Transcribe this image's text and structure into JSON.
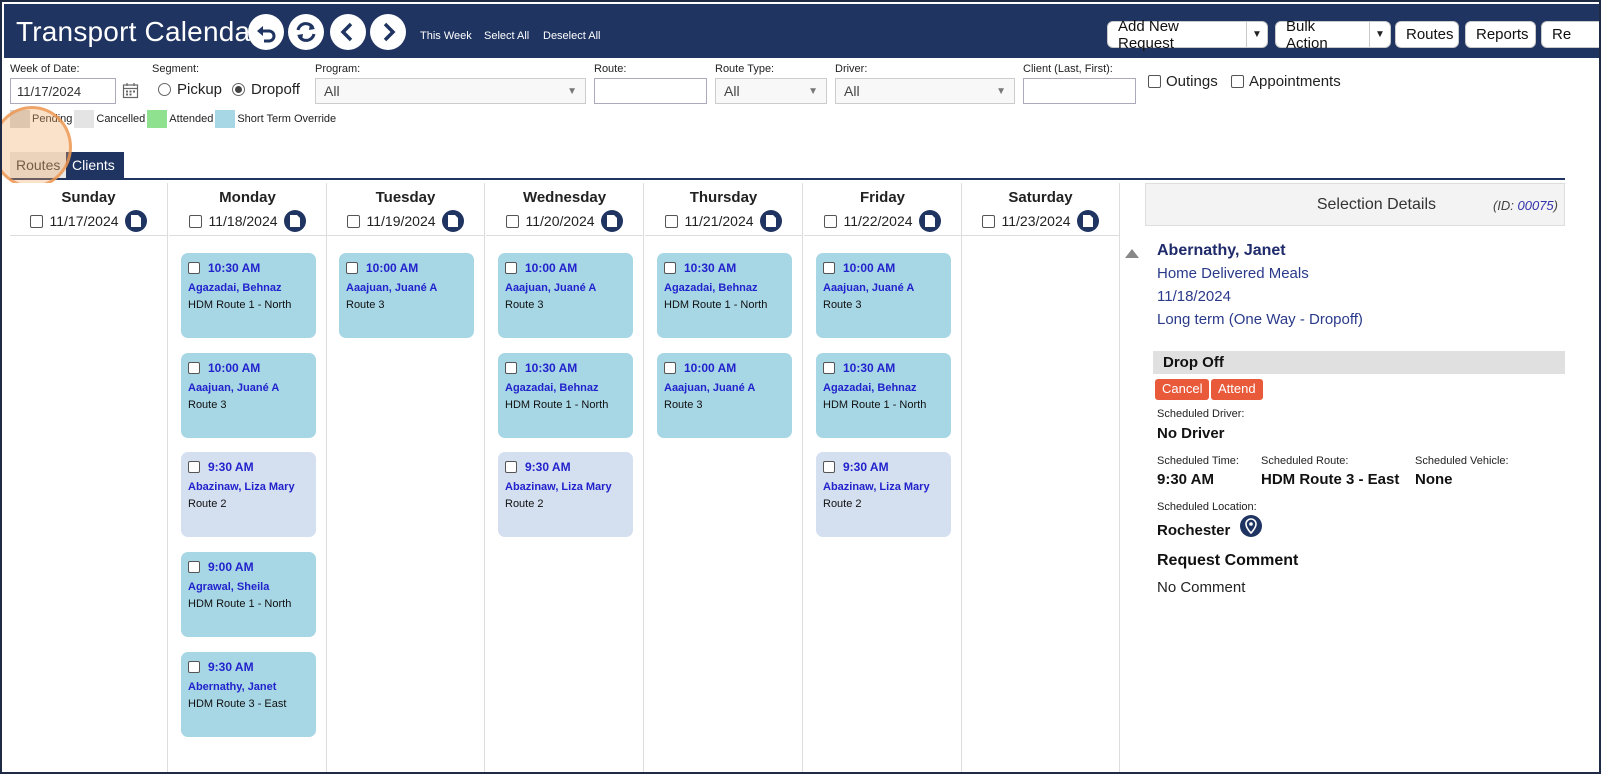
{
  "header": {
    "title": "Transport Calendar",
    "links": {
      "this_week": "This Week",
      "select_all": "Select All",
      "deselect_all": "Deselect All"
    },
    "buttons": {
      "add_new_request": "Add New Request",
      "bulk_action": "Bulk Action",
      "routes": "Routes",
      "reports": "Reports",
      "re": "Re"
    }
  },
  "filters": {
    "week_of_date_label": "Week of Date:",
    "week_of_date_value": "11/17/2024",
    "segment_label": "Segment:",
    "segment_pickup": "Pickup",
    "segment_dropoff": "Dropoff",
    "program_label": "Program:",
    "program_value": "All",
    "route_label": "Route:",
    "route_value": "",
    "route_type_label": "Route Type:",
    "route_type_value": "All",
    "driver_label": "Driver:",
    "driver_value": "All",
    "client_label": "Client (Last, First):",
    "client_value": "",
    "outings": "Outings",
    "appointments": "Appointments"
  },
  "legend": [
    {
      "label": "Pending",
      "color": "#d4d4d4"
    },
    {
      "label": "Cancelled",
      "color": "#e4e4e4"
    },
    {
      "label": "Attended",
      "color": "#8fe08f"
    },
    {
      "label": "Short Term Override",
      "color": "#a7d6e5"
    }
  ],
  "tabs": {
    "routes": "Routes",
    "clients": "Clients"
  },
  "days": [
    {
      "name": "Sunday",
      "date": "11/17/2024",
      "cards": []
    },
    {
      "name": "Monday",
      "date": "11/18/2024",
      "cards": [
        {
          "time": "10:30 AM",
          "client": "Agazadai, Behnaz",
          "route": "HDM Route 1 - North",
          "status": "short"
        },
        {
          "time": "10:00 AM",
          "client": "Aaajuan, Juané A",
          "route": "Route 3",
          "status": "short"
        },
        {
          "time": "9:30 AM",
          "client": "Abazinaw, Liza Mary",
          "route": "Route 2",
          "status": "pending"
        },
        {
          "time": "9:00 AM",
          "client": "Agrawal, Sheila",
          "route": "HDM Route 1 - North",
          "status": "short"
        },
        {
          "time": "9:30 AM",
          "client": "Abernathy, Janet",
          "route": "HDM Route 3 - East",
          "status": "short"
        }
      ]
    },
    {
      "name": "Tuesday",
      "date": "11/19/2024",
      "cards": [
        {
          "time": "10:00 AM",
          "client": "Aaajuan, Juané A",
          "route": "Route 3",
          "status": "short"
        }
      ]
    },
    {
      "name": "Wednesday",
      "date": "11/20/2024",
      "cards": [
        {
          "time": "10:00 AM",
          "client": "Aaajuan, Juané A",
          "route": "Route 3",
          "status": "short"
        },
        {
          "time": "10:30 AM",
          "client": "Agazadai, Behnaz",
          "route": "HDM Route 1 - North",
          "status": "short"
        },
        {
          "time": "9:30 AM",
          "client": "Abazinaw, Liza Mary",
          "route": "Route 2",
          "status": "pending"
        }
      ]
    },
    {
      "name": "Thursday",
      "date": "11/21/2024",
      "cards": [
        {
          "time": "10:30 AM",
          "client": "Agazadai, Behnaz",
          "route": "HDM Route 1 - North",
          "status": "short"
        },
        {
          "time": "10:00 AM",
          "client": "Aaajuan, Juané A",
          "route": "Route 3",
          "status": "short"
        }
      ]
    },
    {
      "name": "Friday",
      "date": "11/22/2024",
      "cards": [
        {
          "time": "10:00 AM",
          "client": "Aaajuan, Juané A",
          "route": "Route 3",
          "status": "short"
        },
        {
          "time": "10:30 AM",
          "client": "Agazadai, Behnaz",
          "route": "HDM Route 1 - North",
          "status": "short"
        },
        {
          "time": "9:30 AM",
          "client": "Abazinaw, Liza Mary",
          "route": "Route 2",
          "status": "pending"
        }
      ]
    },
    {
      "name": "Saturday",
      "date": "11/23/2024",
      "cards": []
    }
  ],
  "details": {
    "title": "Selection Details",
    "id_prefix": "(ID: ",
    "id_value": "00075",
    "id_suffix": ")",
    "client_name": "Abernathy, Janet",
    "program": "Home Delivered Meals",
    "date": "11/18/2024",
    "term": "Long term (One Way - Dropoff)",
    "section": "Drop Off",
    "cancel_btn": "Cancel",
    "attend_btn": "Attend",
    "scheduled_driver_label": "Scheduled Driver:",
    "scheduled_driver": "No Driver",
    "scheduled_time_label": "Scheduled Time:",
    "scheduled_time": "9:30 AM",
    "scheduled_route_label": "Scheduled Route:",
    "scheduled_route": "HDM Route 3 - East",
    "scheduled_vehicle_label": "Scheduled Vehicle:",
    "scheduled_vehicle": "None",
    "scheduled_location_label": "Scheduled Location:",
    "scheduled_location": "Rochester",
    "request_comment_label": "Request Comment",
    "request_comment": "No Comment"
  }
}
